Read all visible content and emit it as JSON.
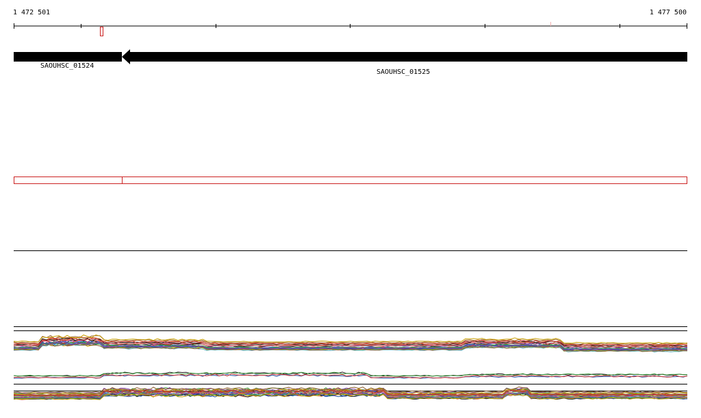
{
  "ruler": {
    "start_label": "1 472 501",
    "end_label": "1 477 500"
  },
  "genes": [
    {
      "name": "SAOUHSC_01524",
      "strand": "-"
    },
    {
      "name": "SAOUHSC_01525",
      "strand": "-"
    }
  ],
  "colors": {
    "gene_fill": "#000000",
    "feature_box": "#cc2222",
    "axis": "#000000",
    "coverage_palette": [
      "#1a1a1a",
      "#2255aa",
      "#3a9a3a",
      "#cc3333",
      "#8a5a2a",
      "#8844aa",
      "#c8a000",
      "#d26a3a",
      "#6a3a8a",
      "#7fbf3f",
      "#2a6ad0",
      "#b05020",
      "#e07070",
      "#5fb0c0",
      "#9c6b3a"
    ]
  }
}
